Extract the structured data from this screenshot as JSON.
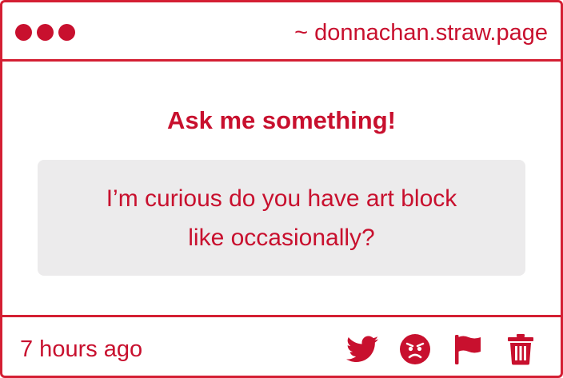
{
  "window": {
    "url": "~ donnachan.straw.page",
    "dots": [
      "dot-1",
      "dot-2",
      "dot-3"
    ]
  },
  "main": {
    "title": "Ask me something!",
    "question": "I’m curious do you have art block like occasionally?"
  },
  "footer": {
    "timestamp": "7 hours ago",
    "actions": [
      {
        "icon": "twitter-icon"
      },
      {
        "icon": "angry-face-icon"
      },
      {
        "icon": "flag-icon"
      },
      {
        "icon": "trash-icon"
      }
    ]
  },
  "colors": {
    "accent": "#c8102e",
    "border": "#d41f33",
    "question_bg": "#ecebec"
  }
}
